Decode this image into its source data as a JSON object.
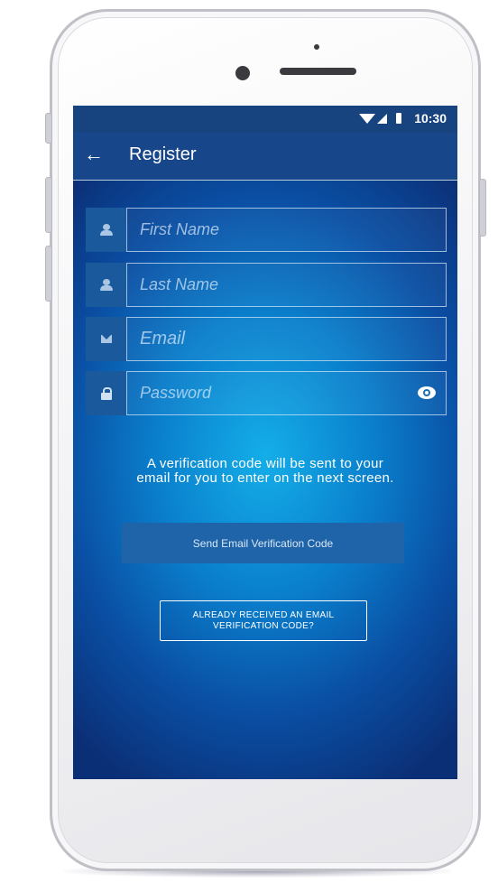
{
  "status_bar": {
    "time": "10:30"
  },
  "toolbar": {
    "title": "Register"
  },
  "form": {
    "first_name_placeholder": "First Name",
    "last_name_placeholder": "Last Name",
    "email_placeholder": "Email",
    "password_placeholder": "Password"
  },
  "info_text": "A verification code will be sent to your email for you to enter on the next screen.",
  "send_button_label": "Send Email Verification Code",
  "already_button_label": "ALREADY RECEIVED AN EMAIL VERIFICATION CODE?",
  "icons": {
    "back": "arrow-left-icon",
    "first_name": "user-icon",
    "last_name": "user-icon",
    "email": "mail-icon",
    "password": "lock-icon",
    "toggle": "eye-icon",
    "wifi": "wifi-icon",
    "signal": "signal-icon",
    "battery": "battery-icon"
  },
  "colors": {
    "toolbar": "#18468a",
    "status_bar": "#17437f",
    "screen_center": "#14aee9",
    "screen_edge": "#0b2f76",
    "button": "#1f63a8"
  }
}
